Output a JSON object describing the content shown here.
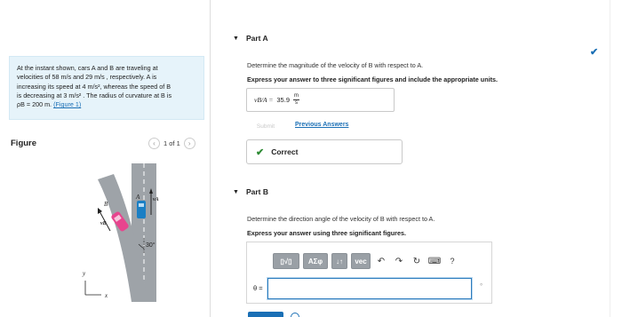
{
  "problem": {
    "line1": "At the instant shown, cars A and B are traveling at",
    "line2": "velocities of 58 m/s and 29 m/s , respectively. A is",
    "line3": "increasing its speed at 4 m/s², whereas the speed of B",
    "line4": "is decreasing at 3 m/s² . The radius of curvature at B is",
    "line5_prefix": "ρB = 200 m.",
    "figure_link": "(Figure 1)"
  },
  "figure": {
    "title": "Figure",
    "pager": "1 of 1",
    "label_A": "A",
    "label_B": "B",
    "label_vA": "vA",
    "label_vB": "vB",
    "label_angle": "30°",
    "axis_x": "x",
    "axis_y": "y"
  },
  "part_a": {
    "header": "Part A",
    "instruction": "Determine the magnitude of the velocity of B with respect to A.",
    "bold_instruction": "Express your answer to three significant figures and include the appropriate units.",
    "answer_var": "vB/A =",
    "answer_value": "35.9",
    "unit_num": "m",
    "unit_den": "s",
    "submit": "Submit",
    "previous_answers": "Previous Answers",
    "correct": "Correct"
  },
  "part_b": {
    "header": "Part B",
    "instruction": "Determine the direction angle of the velocity of B with respect to A.",
    "bold_instruction": "Express your answer using three significant figures.",
    "theta_label": "θ =",
    "degree": "°",
    "toolbar": {
      "templates": "▯√▯",
      "greek": "ΑΣφ",
      "arrows": "↓↑",
      "vec": "vec",
      "help": "?"
    }
  },
  "colors": {
    "accent": "#1a6fb5",
    "correct_green": "#2e8b35",
    "problem_bg": "#e6f3fa",
    "toolbar_gray": "#9aa0a6"
  }
}
